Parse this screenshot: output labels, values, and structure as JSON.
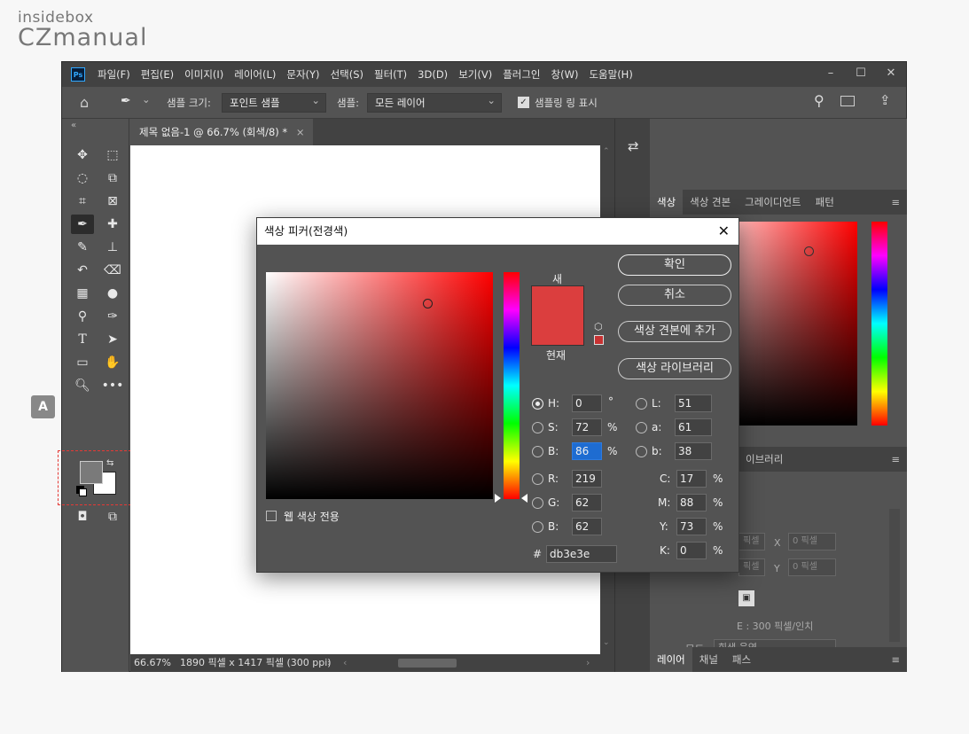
{
  "logo": {
    "line1": "insidebox",
    "line2": "CZmanual"
  },
  "app": {
    "badge": "Ps",
    "menu": [
      "파일(F)",
      "편집(E)",
      "이미지(I)",
      "레이어(L)",
      "문자(Y)",
      "선택(S)",
      "필터(T)",
      "3D(D)",
      "보기(V)",
      "플러그인",
      "창(W)",
      "도움말(H)"
    ],
    "win": [
      "–",
      "☐",
      "✕"
    ]
  },
  "options": {
    "size_label": "샘플 크기:",
    "size_value": "포인트 샘플",
    "sample_label": "샘플:",
    "sample_value": "모든 레이어",
    "ring_label": "샘플링 링 표시"
  },
  "document": {
    "tab": "제목 없음-1 @ 66.7% (회색/8) *",
    "zoom": "66.67%",
    "info": "1890 픽셀 x 1417 픽셀 (300 ppi)"
  },
  "panel": {
    "tabs": [
      "색상",
      "색상 견본",
      "그레이디언트",
      "패턴"
    ],
    "libraries_label": "이브러리",
    "x_label": "X",
    "y_label": "Y",
    "x_placeholder": "0 픽셀",
    "y_placeholder": "0 픽셀",
    "resolution": "E : 300 픽셀/인치",
    "mode_label": "모드",
    "mode_value": "회색 음영",
    "bottom_tabs": [
      "레이어",
      "채널",
      "패스"
    ]
  },
  "callout": {
    "label": "A"
  },
  "dialog": {
    "title": "색상 피커(전경색)",
    "new_label": "새",
    "current_label": "현재",
    "ok": "확인",
    "cancel": "취소",
    "add_swatch": "색상 견본에 추가",
    "libraries": "색상 라이브러리",
    "web_only": "웹 색상 전용",
    "hash": "#",
    "hex": "db3e3e",
    "hsb": [
      {
        "label": "H:",
        "value": "0",
        "unit": "°"
      },
      {
        "label": "S:",
        "value": "72",
        "unit": "%"
      },
      {
        "label": "B:",
        "value": "86",
        "unit": "%"
      }
    ],
    "rgb": [
      {
        "label": "R:",
        "value": "219"
      },
      {
        "label": "G:",
        "value": "62"
      },
      {
        "label": "B:",
        "value": "62"
      }
    ],
    "lab": [
      {
        "label": "L:",
        "value": "51"
      },
      {
        "label": "a:",
        "value": "61"
      },
      {
        "label": "b:",
        "value": "38"
      }
    ],
    "cmyk": [
      {
        "label": "C:",
        "value": "17",
        "unit": "%"
      },
      {
        "label": "M:",
        "value": "88",
        "unit": "%"
      },
      {
        "label": "Y:",
        "value": "73",
        "unit": "%"
      },
      {
        "label": "K:",
        "value": "0",
        "unit": "%"
      }
    ]
  },
  "colors": {
    "picked": "#db3e3e",
    "foreground": "#7a7a7a",
    "background": "#ffffff"
  }
}
